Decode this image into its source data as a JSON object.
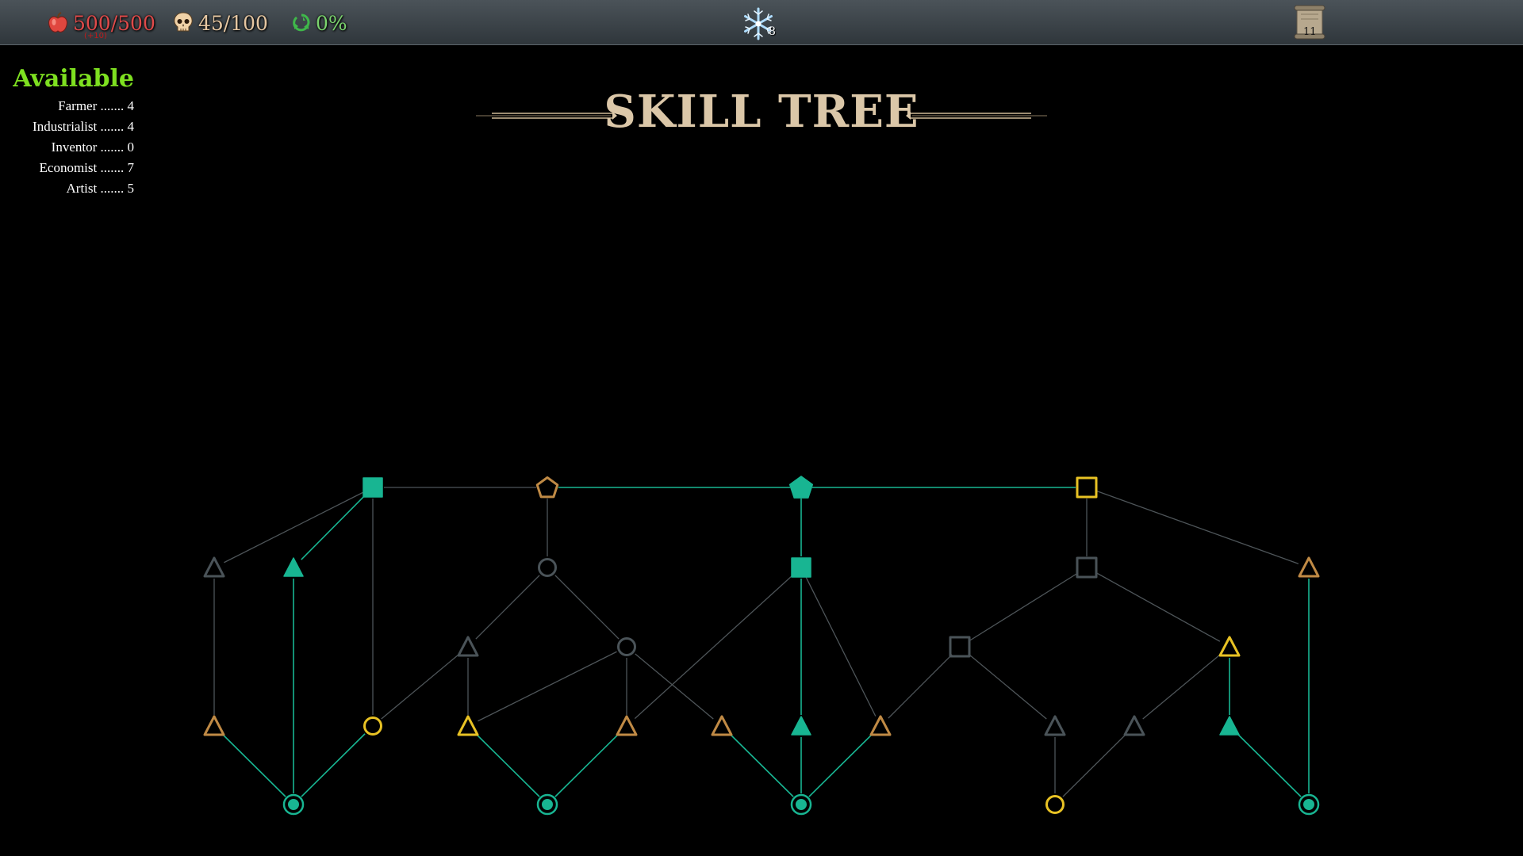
{
  "hud": {
    "food": "500/500",
    "food_delta": "(+10)",
    "deaths": "45/100",
    "recycle": "0%",
    "snow_count": "8",
    "scroll_count": "11"
  },
  "available": {
    "title": "Available",
    "rows": [
      {
        "name": "Farmer",
        "value": "4",
        "text": "Farmer ....... 4"
      },
      {
        "name": "Industrialist",
        "value": "4",
        "text": "Industrialist ....... 4"
      },
      {
        "name": "Inventor",
        "value": "0",
        "text": "Inventor ....... 0"
      },
      {
        "name": "Economist",
        "value": "7",
        "text": "Economist ....... 7"
      },
      {
        "name": "Artist",
        "value": "5",
        "text": "Artist ....... 5"
      }
    ]
  },
  "title": "SKILL TREE",
  "colors": {
    "background": "#000000",
    "teal": "#18b592",
    "gold": "#e8c224",
    "bronze": "#c08a45",
    "gray": "#4a5358",
    "available_green": "#7ee020",
    "title": "#dbc7a8"
  },
  "legend_of_states": {
    "teal": "unlocked",
    "gold": "unlockable",
    "bronze": "partially available",
    "gray": "locked"
  }
}
